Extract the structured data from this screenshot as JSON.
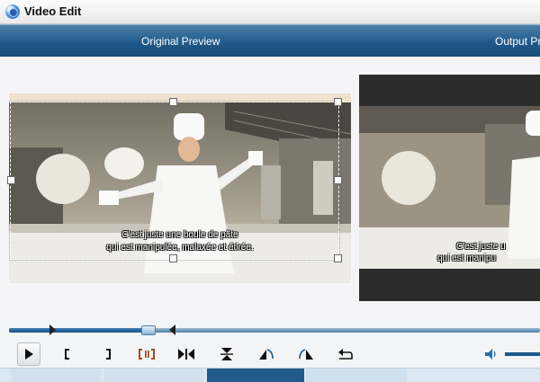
{
  "window": {
    "title": "Video Edit",
    "icon": "app-disc-icon"
  },
  "tabs": {
    "original_preview": "Original Preview",
    "output_preview": "Output Pr"
  },
  "subtitles": {
    "line1": "C'est juste une boule de pâte",
    "line2": "qui est manipulée, malaxée et étirée.",
    "out_line1": "C'est juste u",
    "out_line2": "qui est manipu"
  },
  "controls": {
    "play": "play-icon",
    "mark_in": "mark-in-bracket-icon",
    "mark_out": "mark-out-bracket-icon",
    "split": "split-segment-icon",
    "next_frame": "step-frame-icon",
    "flip_vertical": "flip-vertical-icon",
    "rotate_left": "rotate-left-icon",
    "rotate_right": "rotate-right-icon",
    "undo": "undo-icon",
    "volume": "volume-icon"
  },
  "timeline": {
    "position": 0.27
  },
  "colors": {
    "accent": "#1f5a8a",
    "selected_tab": "#1f5a8a",
    "marker": "#222222"
  }
}
